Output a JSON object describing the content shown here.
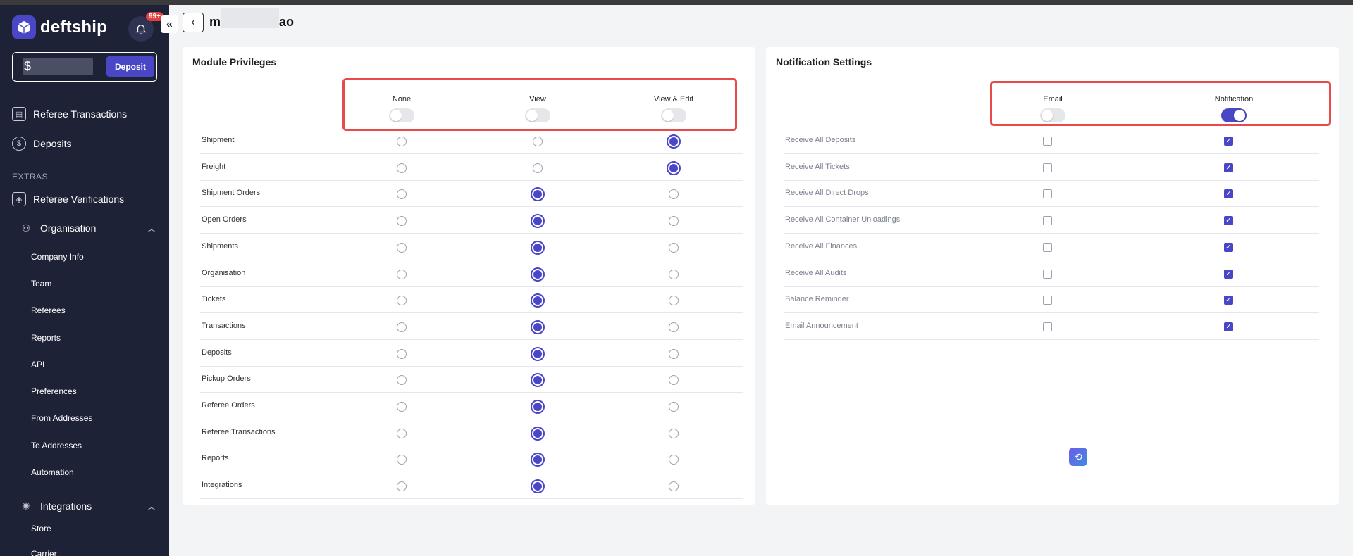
{
  "brand": {
    "name": "deftship",
    "accent": "#4a47c7",
    "sidebar_bg": "#1d2236"
  },
  "notifications": {
    "badge": "99+"
  },
  "balance": {
    "prefix": "$",
    "deposit_label": "Deposit"
  },
  "sidebar": {
    "items": [
      {
        "label": "Referee Transactions",
        "icon": "transactions-icon"
      },
      {
        "label": "Deposits",
        "icon": "dollar-icon"
      }
    ],
    "extras_label": "EXTRAS",
    "extras_items": [
      {
        "label": "Referee Verifications",
        "icon": "box-icon"
      }
    ],
    "organisation": {
      "label": "Organisation",
      "children": [
        "Company Info",
        "Team",
        "Referees",
        "Reports",
        "API",
        "Preferences",
        "From Addresses",
        "To Addresses",
        "Automation"
      ]
    },
    "integrations": {
      "label": "Integrations",
      "children": [
        "Store",
        "Carrier"
      ]
    }
  },
  "header": {
    "title_start": "m",
    "title_end": "ao"
  },
  "privileges": {
    "title": "Module Privileges",
    "columns": [
      {
        "label": "None",
        "toggle_on": false
      },
      {
        "label": "View",
        "toggle_on": false
      },
      {
        "label": "View & Edit",
        "toggle_on": false
      }
    ],
    "rows": [
      {
        "label": "Shipment",
        "selected": 2
      },
      {
        "label": "Freight",
        "selected": 2
      },
      {
        "label": "Shipment Orders",
        "selected": 1
      },
      {
        "label": "Open Orders",
        "selected": 1
      },
      {
        "label": "Shipments",
        "selected": 1
      },
      {
        "label": "Organisation",
        "selected": 1
      },
      {
        "label": "Tickets",
        "selected": 1
      },
      {
        "label": "Transactions",
        "selected": 1
      },
      {
        "label": "Deposits",
        "selected": 1
      },
      {
        "label": "Pickup Orders",
        "selected": 1
      },
      {
        "label": "Referee Orders",
        "selected": 1
      },
      {
        "label": "Referee Transactions",
        "selected": 1
      },
      {
        "label": "Reports",
        "selected": 1
      },
      {
        "label": "Integrations",
        "selected": 1
      }
    ]
  },
  "notif_settings": {
    "title": "Notification Settings",
    "columns": [
      {
        "label": "Email",
        "toggle_on": false
      },
      {
        "label": "Notification",
        "toggle_on": true
      }
    ],
    "rows": [
      {
        "label": "Receive All Deposits",
        "email": false,
        "notification": true
      },
      {
        "label": "Receive All Tickets",
        "email": false,
        "notification": true
      },
      {
        "label": "Receive All Direct Drops",
        "email": false,
        "notification": true
      },
      {
        "label": "Receive All Container Unloadings",
        "email": false,
        "notification": true
      },
      {
        "label": "Receive All Finances",
        "email": false,
        "notification": true
      },
      {
        "label": "Receive All Audits",
        "email": false,
        "notification": true
      },
      {
        "label": "Balance Reminder",
        "email": false,
        "notification": true
      },
      {
        "label": "Email Announcement",
        "email": false,
        "notification": true
      }
    ]
  }
}
